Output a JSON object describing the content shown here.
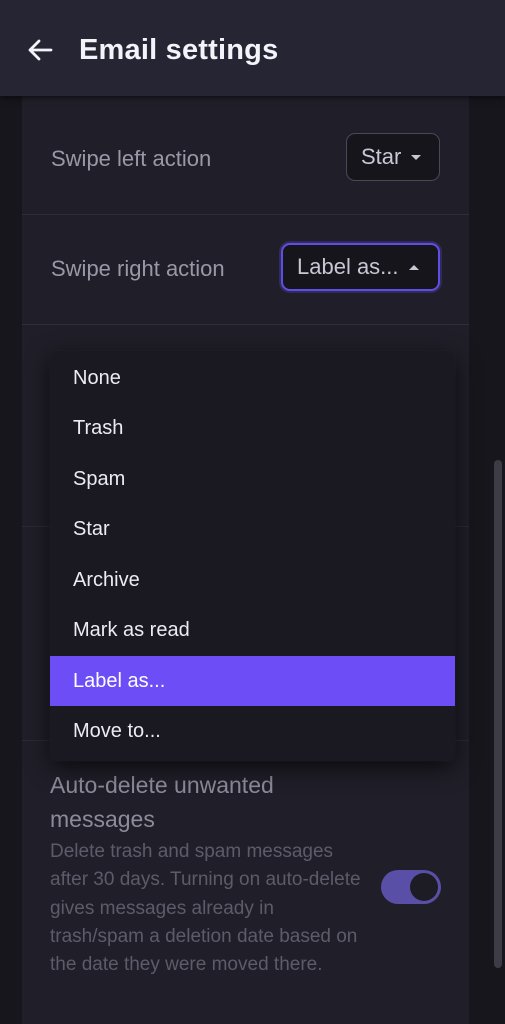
{
  "header": {
    "title": "Email settings",
    "back_icon": "arrow-left-icon"
  },
  "settings": {
    "swipe_left": {
      "label": "Swipe left action",
      "value": "Star",
      "dropdown_open": false
    },
    "swipe_right": {
      "label": "Swipe right action",
      "value": "Label as...",
      "dropdown_open": true
    }
  },
  "dropdown": {
    "options": [
      "None",
      "Trash",
      "Spam",
      "Star",
      "Archive",
      "Mark as read",
      "Label as...",
      "Move to..."
    ],
    "selected_index": 6
  },
  "auto_delete": {
    "title": "Auto-delete unwanted messages",
    "description": "Delete trash and spam messages after 30 days. Turning on auto-delete gives messages already in trash/spam a deletion date based on the date they were moved there.",
    "enabled": true
  },
  "colors": {
    "accent": "#6d4ef6",
    "background": "#1b1a23",
    "header": "#262534",
    "toggle_track": "#5a4fa6"
  }
}
